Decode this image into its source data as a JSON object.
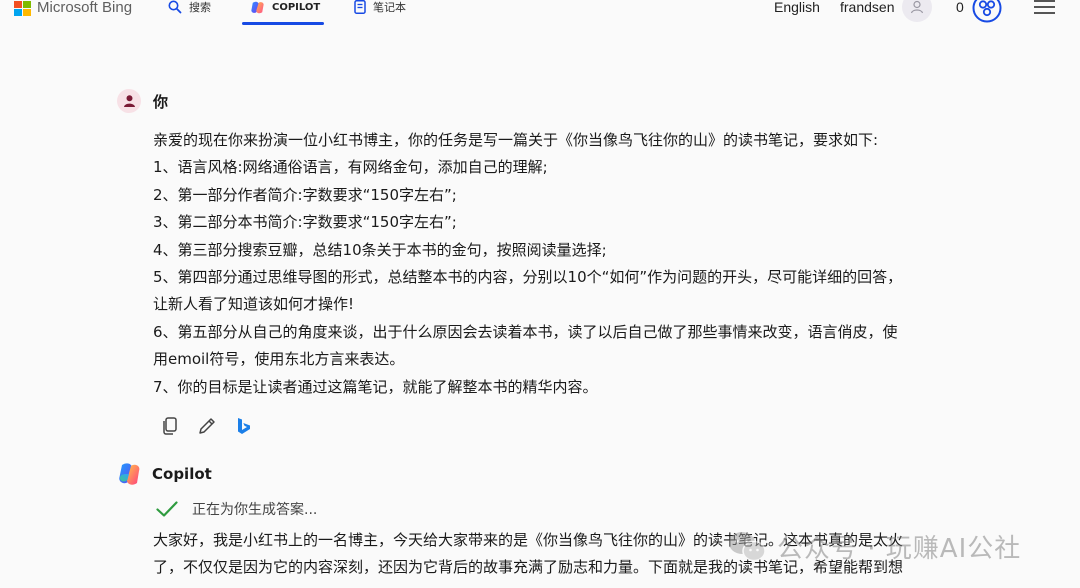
{
  "header": {
    "logo_text": "Microsoft Bing",
    "nav": [
      {
        "label": "搜索",
        "icon": "search-icon"
      },
      {
        "label": "COPILOT",
        "icon": "copilot-icon",
        "active": true
      },
      {
        "label": "笔记本",
        "icon": "notebook-icon"
      }
    ],
    "language": "English",
    "username": "frandsen",
    "rewards_count": "0"
  },
  "user_message": {
    "sender": "你",
    "lines": [
      "亲爱的现在你来扮演一位小红书博主，你的任务是写一篇关于《你当像鸟飞往你的山》的读书笔记，要求如下:",
      "1、语言风格:网络通俗语言，有网络金句，添加自己的理解;",
      "2、第一部分作者简介:字数要求“150字左右”;",
      "3、第二部分本书简介:字数要求“150字左右”;",
      "4、第三部分搜索豆瓣，总结10条关于本书的金句，按照阅读量选择;",
      "5、第四部分通过思维导图的形式，总结整本书的内容，分别以10个“如何”作为问题的开头，尽可能详细的回答，",
      "让新人看了知道该如何才操作!",
      "6、第五部分从自己的角度来谈，出于什么原因会去读着本书，读了以后自己做了那些事情来改变，语言俏皮，使",
      "用emoil符号，使用东北方言来表达。",
      "7、你的目标是让读者通过这篇笔记，就能了解整本书的精华内容。"
    ]
  },
  "copilot": {
    "sender": "Copilot",
    "status": "正在为你生成答案...",
    "lines": [
      "大家好，我是小红书上的一名博主，今天给大家带来的是《你当像鸟飞往你的山》的读书笔记。这本书真的是太火",
      "了，不仅仅是因为它的内容深刻，还因为它背后的故事充满了励志和力量。下面就是我的读书笔记，希望能帮到想"
    ]
  },
  "watermark": {
    "text": "公众号 · 玩赚AI公社"
  },
  "colors": {
    "accent": "#174ae4",
    "check": "#2e9b3f"
  }
}
